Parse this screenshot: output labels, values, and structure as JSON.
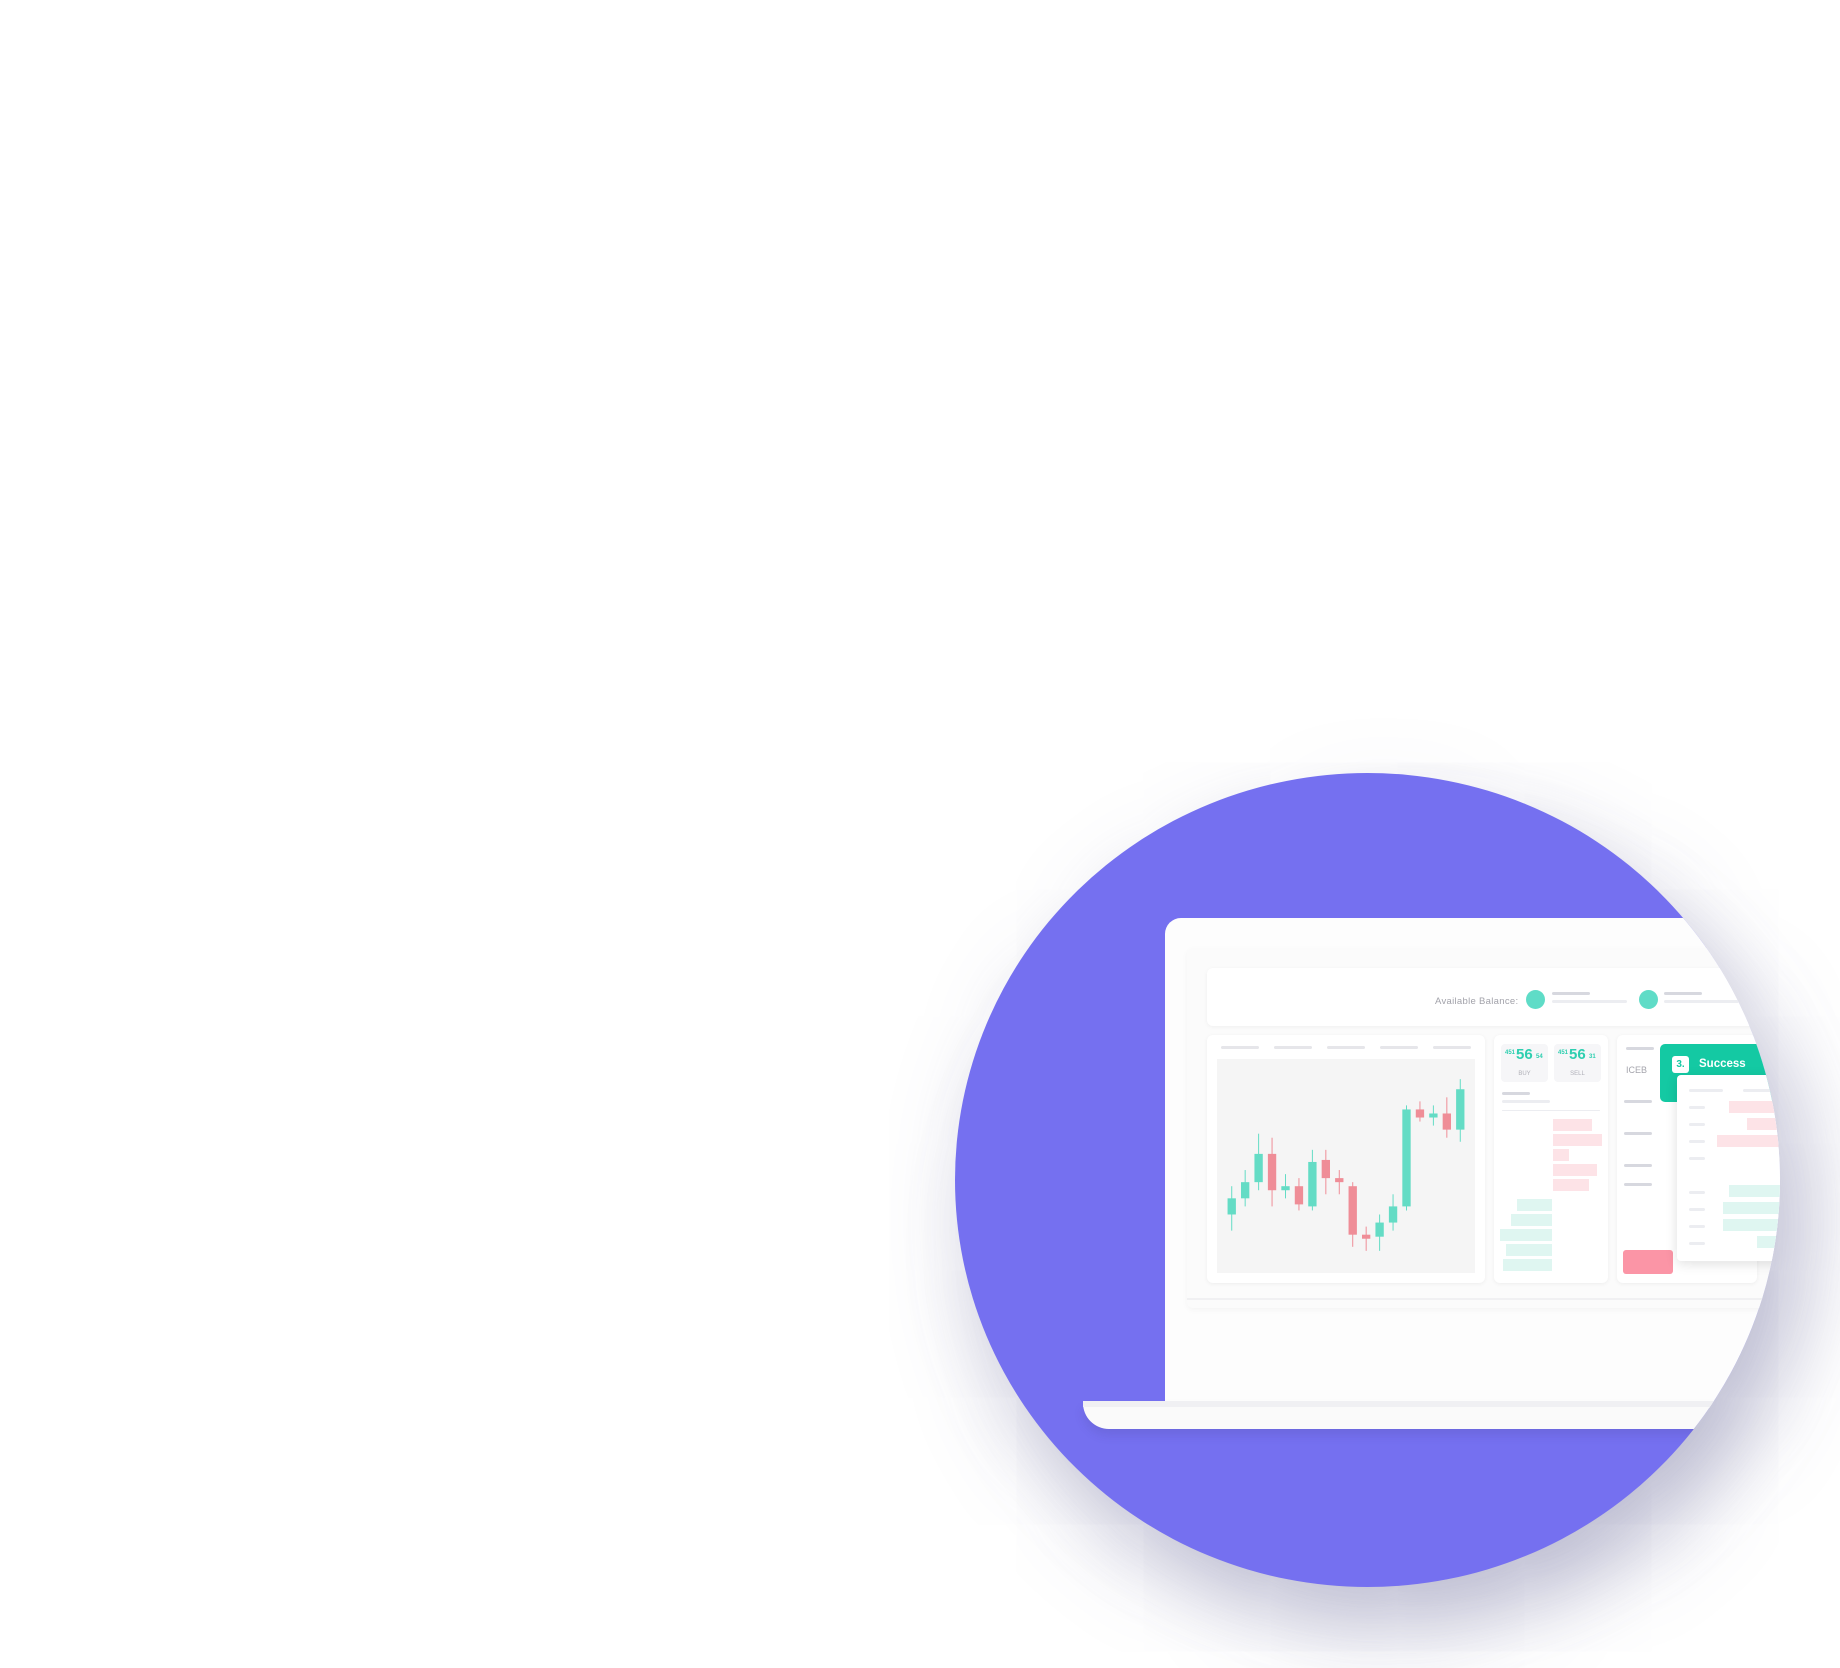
{
  "colors": {
    "background": "#ffffff",
    "circle": "#7570f0",
    "accent_green": "#14c9a3",
    "candle_up": "#64dcc5",
    "candle_down": "#ef8d97",
    "ask_bar": "#fde3e7",
    "bid_bar": "#dff6f1",
    "sell_button": "#fb95a6"
  },
  "header": {
    "balance_label": "Available Balance:",
    "coin_icon": "coin-icon"
  },
  "quotes": {
    "buy": {
      "prefix": "451",
      "main": "56",
      "suffix": "54",
      "label": "BUY"
    },
    "sell": {
      "prefix": "451",
      "main": "56",
      "suffix": "31",
      "label": "SELL"
    }
  },
  "order_form": {
    "partial_label": "ICEB"
  },
  "toast": {
    "step": "3.",
    "text": "Success"
  },
  "chart_data": {
    "type": "candlestick",
    "title": "",
    "xlabel": "",
    "ylabel": "",
    "ylim": [
      0,
      100
    ],
    "candles": [
      {
        "open": 26,
        "close": 34,
        "high": 40,
        "low": 18
      },
      {
        "open": 34,
        "close": 42,
        "high": 48,
        "low": 30
      },
      {
        "open": 42,
        "close": 56,
        "high": 66,
        "low": 38
      },
      {
        "open": 56,
        "close": 38,
        "high": 64,
        "low": 30
      },
      {
        "open": 38,
        "close": 40,
        "high": 46,
        "low": 34
      },
      {
        "open": 40,
        "close": 31,
        "high": 44,
        "low": 28
      },
      {
        "open": 30,
        "close": 52,
        "high": 58,
        "low": 28
      },
      {
        "open": 53,
        "close": 44,
        "high": 58,
        "low": 36
      },
      {
        "open": 44,
        "close": 42,
        "high": 48,
        "low": 36
      },
      {
        "open": 40,
        "close": 16,
        "high": 42,
        "low": 10
      },
      {
        "open": 16,
        "close": 14,
        "high": 20,
        "low": 8
      },
      {
        "open": 15,
        "close": 22,
        "high": 26,
        "low": 8
      },
      {
        "open": 22,
        "close": 30,
        "high": 36,
        "low": 18
      },
      {
        "open": 30,
        "close": 78,
        "high": 80,
        "low": 28
      },
      {
        "open": 78,
        "close": 74,
        "high": 82,
        "low": 72
      },
      {
        "open": 74,
        "close": 76,
        "high": 80,
        "low": 70
      },
      {
        "open": 76,
        "close": 68,
        "high": 84,
        "low": 64
      },
      {
        "open": 68,
        "close": 88,
        "high": 93,
        "low": 62
      }
    ]
  }
}
